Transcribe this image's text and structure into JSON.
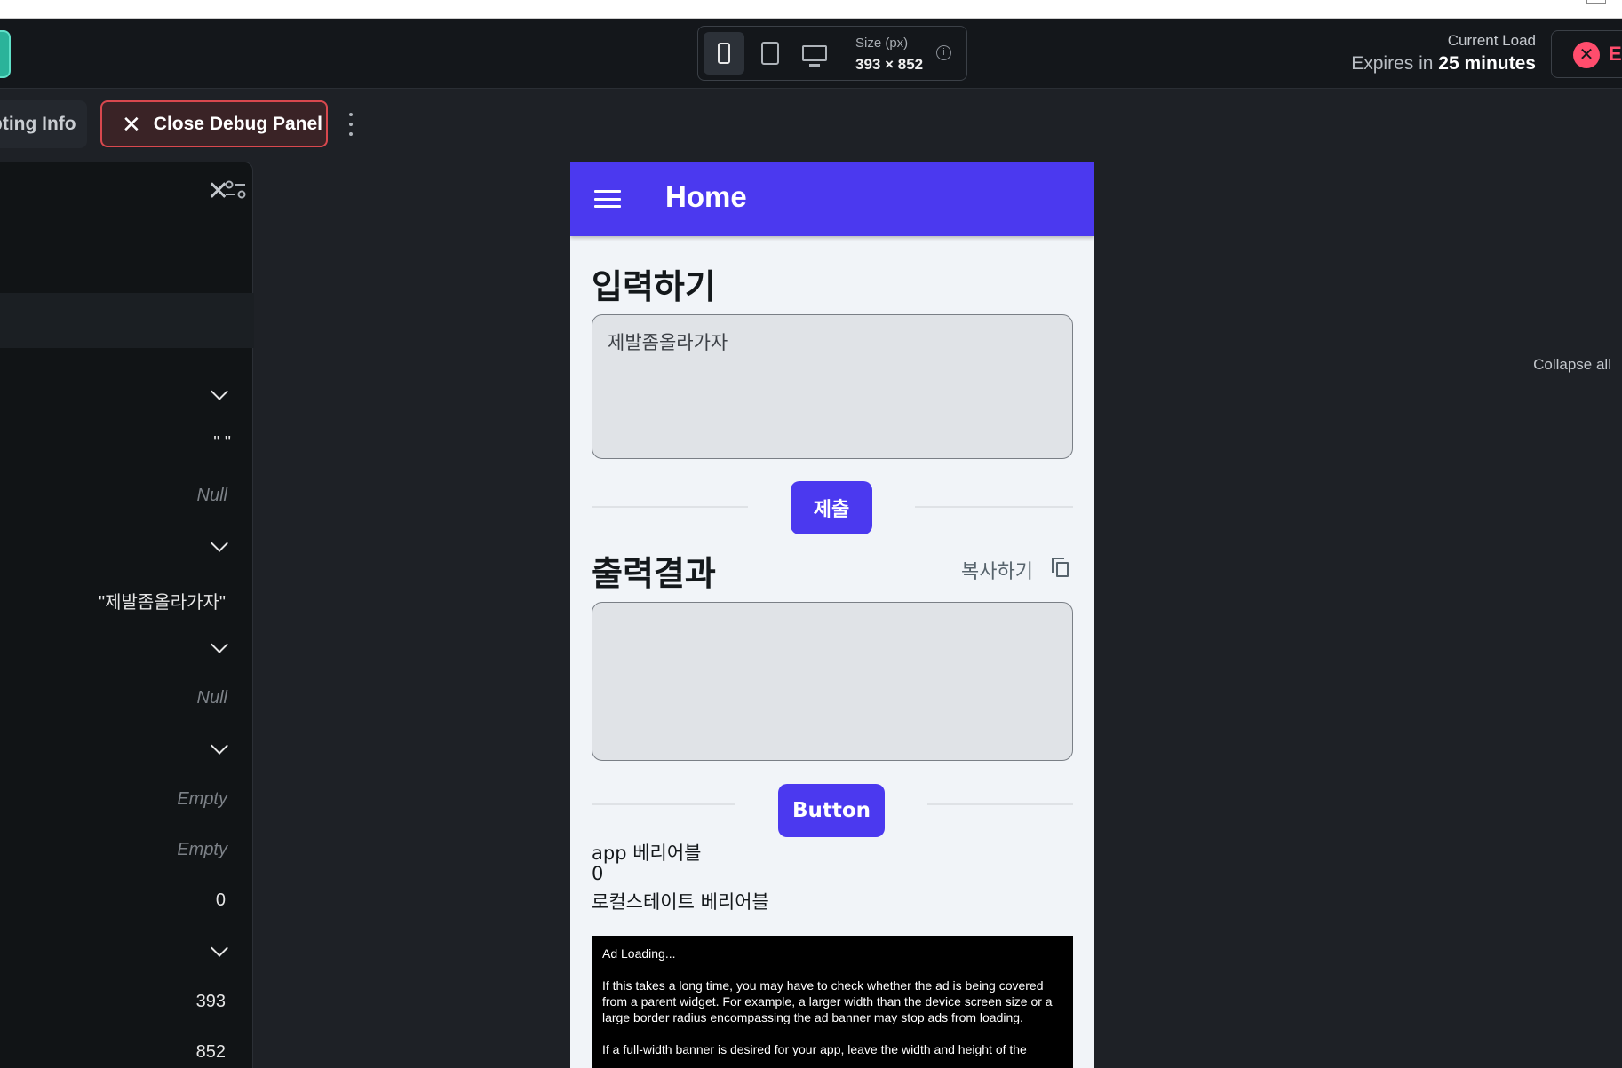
{
  "toolbar": {
    "size_label": "Size (px)",
    "size_value": "393 × 852",
    "current_load_label": "Current Load",
    "expires_prefix": "Expires in",
    "expires_value": "25 minutes",
    "right_button_partial": "E"
  },
  "subbar": {
    "partial_tab": "pting Info",
    "close_debug_label": "Close Debug Panel"
  },
  "debug_panel": {
    "collapse_all": "Collapse all",
    "rows": [
      {
        "value": "\"  \""
      },
      {
        "value": "Null"
      },
      {
        "value": "\"제발좀올라가자\""
      },
      {
        "value": "Null"
      },
      {
        "value": "Empty"
      },
      {
        "value": "Empty"
      },
      {
        "value": "0"
      },
      {
        "value": "393"
      },
      {
        "value": "852"
      }
    ]
  },
  "phone": {
    "app_bar_title": "Home",
    "input_section_title": "입력하기",
    "input_value": "제발좀올라가자",
    "submit_label": "제출",
    "output_section_title": "출력결과",
    "copy_label": "복사하기",
    "output_value": "",
    "button_label": "Button",
    "app_variable_label": "app 베리어블",
    "app_variable_value": "0",
    "local_state_label": "로컬스테이트 베리어블",
    "ad": {
      "loading": "Ad Loading...",
      "para1": "If this takes a long time, you may have to check whether the ad is being covered from a parent widget. For example, a larger width than the device screen size or a large border radius encompassing the ad banner may stop ads from loading.",
      "para2": "If a full-width banner is desired for your app, leave the width and height of the"
    }
  },
  "colors": {
    "app_bar": "#4b39ef",
    "close_debug_border": "#d9484e",
    "close_right_icon": "#ff4d6d",
    "phone_background": "#f1f4f8"
  }
}
